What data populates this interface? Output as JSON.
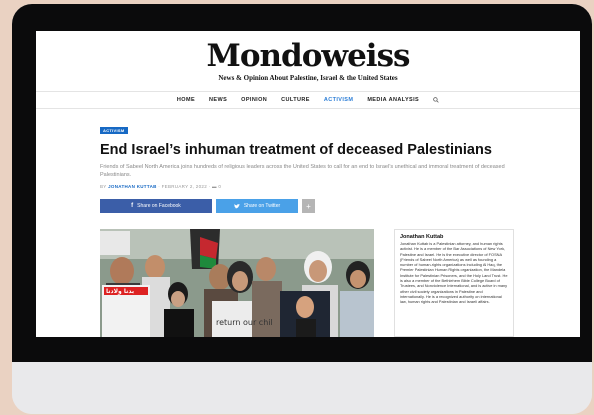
{
  "site": {
    "logo": "Mondoweiss",
    "tagline": "News & Opinion About Palestine, Israel & the United States"
  },
  "nav": {
    "items": [
      "HOME",
      "NEWS",
      "OPINION",
      "CULTURE",
      "ACTIVISM",
      "MEDIA ANALYSIS"
    ],
    "active": "ACTIVISM"
  },
  "article": {
    "tag": "ACTIVISM",
    "headline": "End Israel’s inhuman treatment of deceased Palestinians",
    "dek": "Friends of Sabeel North America joins hundreds of religious leaders across the United States to call for an end to Israel’s unethical and immoral treatment of deceased Palestinians.",
    "by": "BY",
    "author": "JONATHAN KUTTAB",
    "date": "FEBRUARY 2, 2022",
    "comments": "0"
  },
  "share": {
    "facebook": "Share on Facebook",
    "twitter": "Share on Twitter",
    "more": "+"
  },
  "photo": {
    "sign_left": "بدنا ولادنا",
    "sign_right": "return our chil"
  },
  "bio": {
    "name": "Jonathan Kuttab",
    "text": "Jonathan Kuttab is a Palestinian attorney, and human rights activist. He is a member of the Bar Associations of New York, Palestine and Israel. He is the executive director of FOSNA (Friends of Sabeel North America) as well as founding a number of human-rights organizations including Al Haq, the Premier Palestinian Human Rights organization, the Mandela Institute for Palestinian Prisoners, and the Holy Land Trust. He is also a member of the Bethlehem Bible College Board of Trustees, and Nonviolence International, and is active in many other civil society organizations in Palestine and internationally. He is a recognized authority on international law, human rights and Palestinian and Israeli affairs."
  },
  "colors": {
    "accent": "#1769c4",
    "facebook": "#3b5ea8",
    "twitter": "#4aa1e8",
    "background": "#ead2c2"
  }
}
